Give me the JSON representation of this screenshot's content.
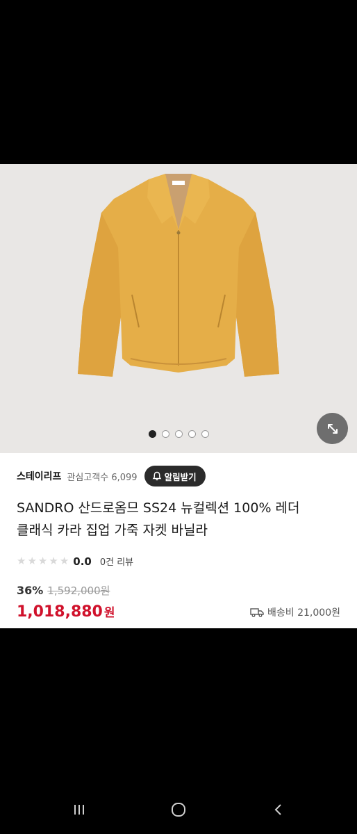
{
  "gallery": {
    "total_images": 5,
    "active_index": 0
  },
  "seller": {
    "name": "스테이리프",
    "watchers_label": "관심고객수 6,099",
    "alert_label": "알림받기"
  },
  "product": {
    "title_line1": "SANDRO 산드로옴므 SS24 뉴컬렉션 100% 레더",
    "title_line2": "클래식 카라 집업 가죽 자켓 바닐라",
    "rating": "0.0",
    "rating_stars": 0,
    "review_count_label": "0건 리뷰",
    "discount": "36%",
    "original_price": "1,592,000원",
    "sale_price": "1,018,880",
    "currency": "원",
    "shipping_label": "배송비 21,000원"
  },
  "colors": {
    "price_red": "#d0112b",
    "image_bg": "#e9e7e5",
    "jacket_color": "#e7b14a"
  },
  "icons": {
    "expand": "expand-icon",
    "bell": "bell-icon",
    "truck": "truck-icon",
    "recents": "recents-icon",
    "home": "home-icon",
    "back": "back-icon"
  }
}
